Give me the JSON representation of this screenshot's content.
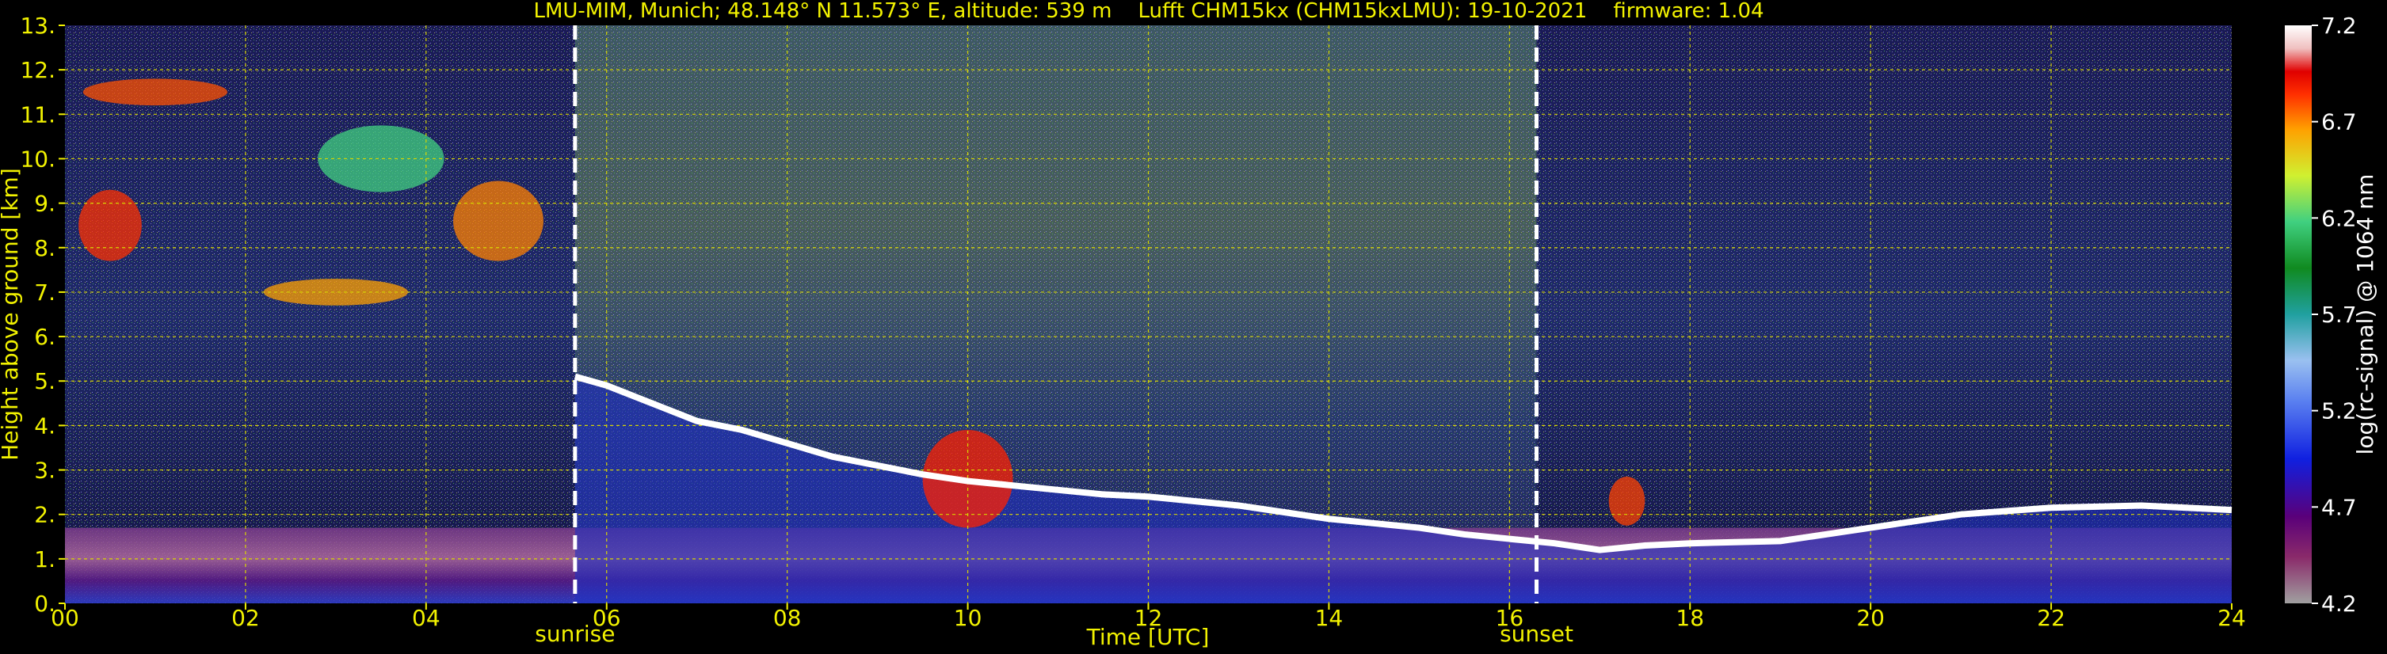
{
  "chart_data": {
    "type": "heatmap",
    "title": "LMU-MIM, Munich; 48.148° N 11.573° E, altitude: 539 m    Lufft CHM15kx (CHM15kxLMU): 19-10-2021    firmware: 1.04",
    "xlabel": "Time [UTC]",
    "ylabel": "Height above ground [km]",
    "xlim": [
      0,
      24
    ],
    "ylim": [
      0,
      13
    ],
    "x_ticks": [
      "00",
      "02",
      "04",
      "06",
      "08",
      "10",
      "12",
      "14",
      "16",
      "18",
      "20",
      "22",
      "24"
    ],
    "y_ticks": [
      "0.",
      "1.",
      "2.",
      "3.",
      "4.",
      "5.",
      "6.",
      "7.",
      "8.",
      "9.",
      "10.",
      "11.",
      "12.",
      "13."
    ],
    "grid": true,
    "markers": [
      {
        "label": "sunrise",
        "time": 5.65
      },
      {
        "label": "sunset",
        "time": 16.3
      }
    ],
    "colorbar": {
      "label": "log(rc-signal) @ 1064 nm",
      "range": [
        4.2,
        7.2
      ],
      "ticks": [
        "7.2",
        "6.7",
        "6.2",
        "5.7",
        "5.2",
        "4.7",
        "4.2"
      ]
    },
    "boundary_layer_top": [
      [
        5.65,
        5.1
      ],
      [
        6.0,
        4.9
      ],
      [
        6.5,
        4.5
      ],
      [
        7.0,
        4.1
      ],
      [
        7.5,
        3.9
      ],
      [
        8.0,
        3.6
      ],
      [
        8.5,
        3.3
      ],
      [
        9.0,
        3.1
      ],
      [
        9.5,
        2.9
      ],
      [
        10.0,
        2.75
      ],
      [
        10.5,
        2.65
      ],
      [
        11.0,
        2.55
      ],
      [
        11.5,
        2.45
      ],
      [
        12.0,
        2.4
      ],
      [
        12.5,
        2.3
      ],
      [
        13.0,
        2.2
      ],
      [
        13.5,
        2.05
      ],
      [
        14.0,
        1.9
      ],
      [
        14.5,
        1.8
      ],
      [
        15.0,
        1.7
      ],
      [
        15.5,
        1.55
      ],
      [
        16.0,
        1.45
      ],
      [
        16.5,
        1.35
      ],
      [
        17.0,
        1.2
      ],
      [
        17.5,
        1.3
      ],
      [
        18.0,
        1.35
      ],
      [
        19.0,
        1.4
      ],
      [
        20.0,
        1.7
      ],
      [
        21.0,
        2.0
      ],
      [
        22.0,
        2.15
      ],
      [
        23.0,
        2.2
      ],
      [
        24.0,
        2.1
      ]
    ]
  }
}
